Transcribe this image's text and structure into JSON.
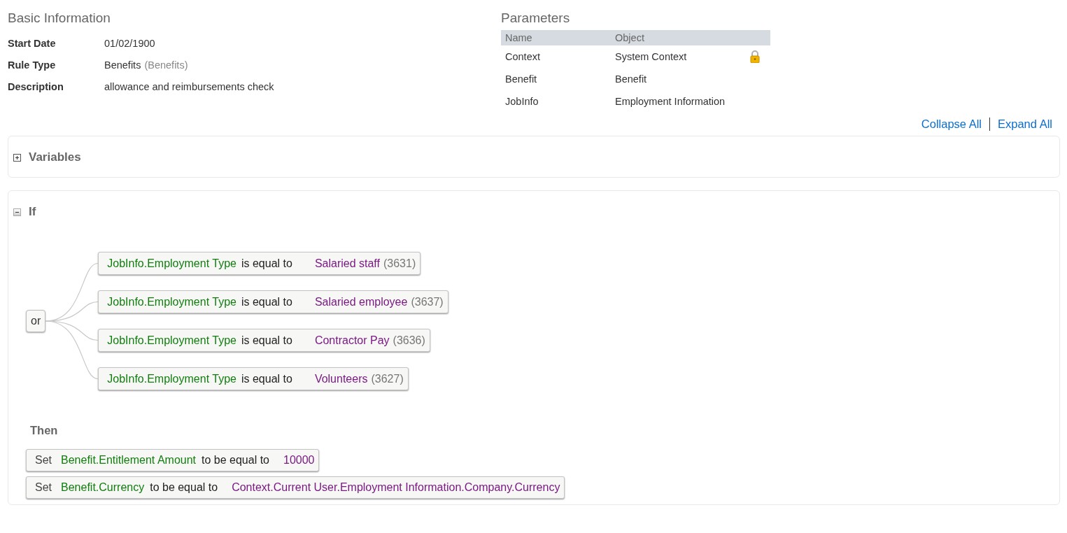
{
  "basic_information": {
    "title": "Basic Information",
    "fields": [
      {
        "label": "Start Date",
        "value": "01/02/1900"
      },
      {
        "label": "Rule Type",
        "value": "Benefits",
        "code": "(Benefits)"
      },
      {
        "label": "Description",
        "value": "allowance and reimbursements check"
      }
    ]
  },
  "parameters": {
    "title": "Parameters",
    "columns": [
      "Name",
      "Object"
    ],
    "rows": [
      {
        "name": "Context",
        "object": "System Context",
        "locked": true
      },
      {
        "name": "Benefit",
        "object": "Benefit",
        "locked": false
      },
      {
        "name": "JobInfo",
        "object": "Employment Information",
        "locked": false
      }
    ]
  },
  "links": [
    "Collapse All",
    "Expand All"
  ],
  "variables": {
    "title": "Variables",
    "expanded": false
  },
  "if_section": {
    "title": "If",
    "expanded": true,
    "operator": "or",
    "conditions": [
      {
        "field": "JobInfo.Employment Type",
        "comparison": "is equal to",
        "value": "Salaried staff",
        "code": "(3631)"
      },
      {
        "field": "JobInfo.Employment Type",
        "comparison": "is equal to",
        "value": "Salaried employee",
        "code": "(3637)"
      },
      {
        "field": "JobInfo.Employment Type",
        "comparison": "is equal to",
        "value": "Contractor Pay",
        "code": "(3636)"
      },
      {
        "field": "JobInfo.Employment Type",
        "comparison": "is equal to",
        "value": "Volunteers",
        "code": "(3627)"
      }
    ],
    "then_title": "Then",
    "actions": [
      {
        "verb": "Set",
        "field": "Benefit.Entitlement Amount",
        "comparison": "to be equal to",
        "value": "10000"
      },
      {
        "verb": "Set",
        "field": "Benefit.Currency",
        "comparison": "to be equal to",
        "value": "Context.Current User.Employment Information.Company.Currency"
      }
    ]
  }
}
